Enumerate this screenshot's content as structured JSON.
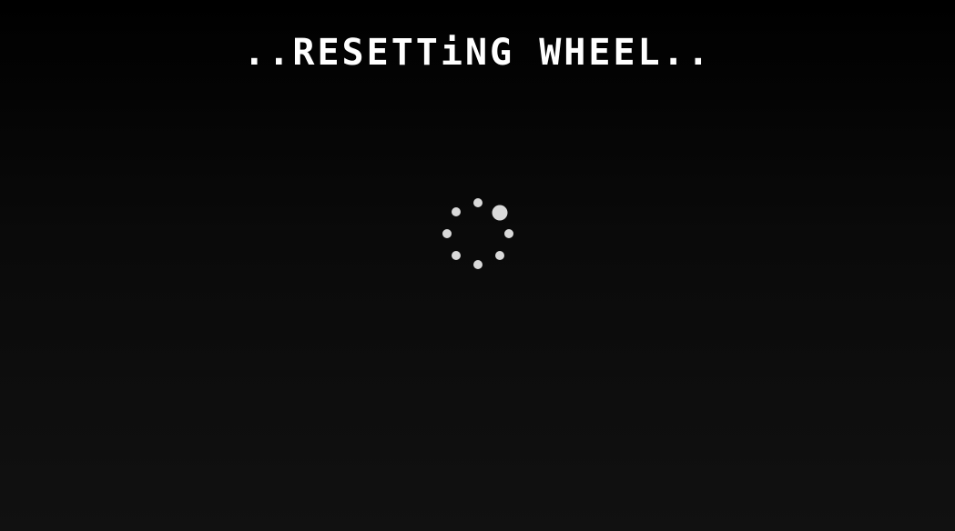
{
  "screen": {
    "status_text": "..RESETTiNG WHEEL..",
    "background_color": "#000000",
    "text_color": "#ffffff"
  },
  "loading_spinner": {
    "icon": "loading-spinner-icon",
    "dot_count": 8,
    "active_dot_index": 1,
    "dot_color": "#d9d9d9"
  }
}
